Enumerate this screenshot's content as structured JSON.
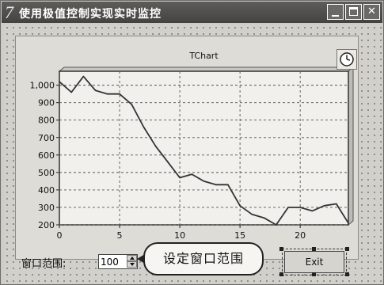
{
  "window": {
    "title": "使用极值控制实现实时监控",
    "icon": "7",
    "buttons": [
      "minimize-icon",
      "maximize-icon",
      "close-icon"
    ]
  },
  "chart_data": {
    "type": "line",
    "title": "TChart",
    "xlabel": "",
    "ylabel": "",
    "xlim": [
      0,
      24
    ],
    "ylim": [
      200,
      1080
    ],
    "x_ticks": [
      0,
      5,
      10,
      15,
      20
    ],
    "y_ticks": [
      200,
      300,
      400,
      500,
      600,
      700,
      800,
      900,
      1000
    ],
    "y_tick_labels": [
      "200",
      "300",
      "400",
      "500",
      "600",
      "700",
      "800",
      "900",
      "1,000"
    ],
    "grid": true,
    "series": [
      {
        "color": "#333333",
        "x": [
          0,
          1,
          2,
          3,
          4,
          5,
          6,
          7,
          8,
          9,
          10,
          11,
          12,
          13,
          14,
          15,
          16,
          17,
          18,
          19,
          20,
          21,
          22,
          23,
          24
        ],
        "y": [
          1020,
          960,
          1050,
          970,
          950,
          950,
          890,
          760,
          650,
          560,
          470,
          490,
          450,
          430,
          430,
          310,
          260,
          240,
          200,
          300,
          300,
          280,
          310,
          320,
          210
        ]
      }
    ]
  },
  "toolbar": {
    "clock_icon": "clock-icon"
  },
  "controls": {
    "window_range_label": "窗口范围:",
    "window_range_value": "100",
    "callout_text": "设定窗口范围",
    "exit_label": "Exit"
  }
}
